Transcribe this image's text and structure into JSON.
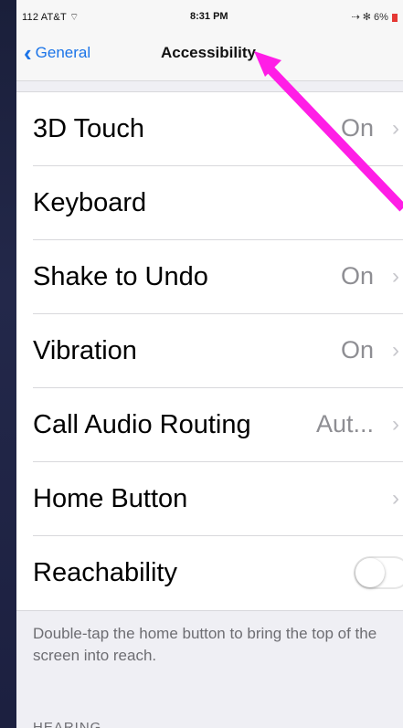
{
  "status_bar": {
    "carrier": "112 AT&T",
    "wifi_icon": "wifi-icon",
    "time": "8:31 PM",
    "battery_text": "⇢ ✻ 6%"
  },
  "nav": {
    "back_label": "General",
    "title": "Accessibility"
  },
  "rows": [
    {
      "label": "3D Touch",
      "value": "On",
      "chevron": "›"
    },
    {
      "label": "Keyboard",
      "value": "",
      "chevron": ""
    },
    {
      "label": "Shake to Undo",
      "value": "On",
      "chevron": "›"
    },
    {
      "label": "Vibration",
      "value": "On",
      "chevron": "›"
    },
    {
      "label": "Call Audio Routing",
      "value": "Aut...",
      "chevron": "›"
    },
    {
      "label": "Home Button",
      "value": "",
      "chevron": "›"
    },
    {
      "label": "Reachability",
      "toggle": false
    }
  ],
  "footer_text": "Double-tap the home button to bring the top of the screen into reach.",
  "next_section_header": "HEARING",
  "colors": {
    "accent": "#1b74e8",
    "annotation_arrow": "#ff1ee6"
  }
}
